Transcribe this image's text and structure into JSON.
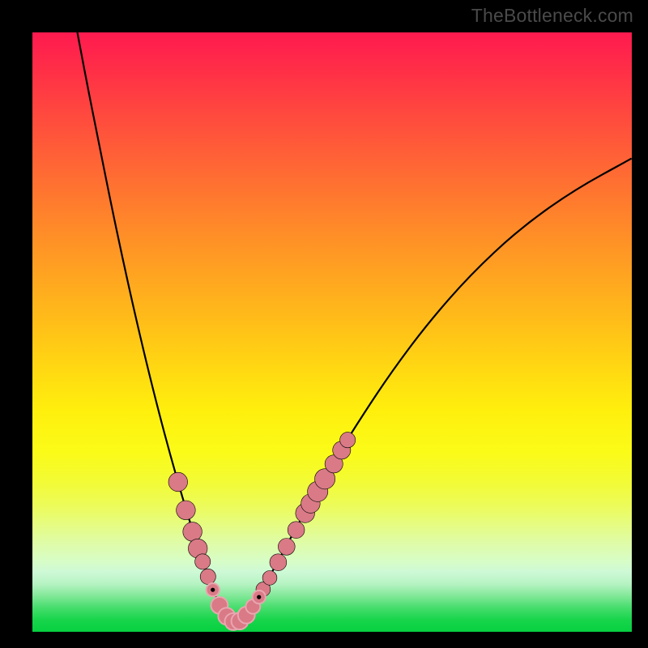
{
  "watermark": "TheBottleneck.com",
  "colors": {
    "frame": "#000000",
    "curve": "#000000",
    "marker_fill": "#d97a86",
    "marker_stroke": "#000000",
    "gradient_top": "#ff1a4f",
    "gradient_bottom": "#06d040"
  },
  "chart_data": {
    "type": "line",
    "title": "",
    "xlabel": "",
    "ylabel": "",
    "xlim": [
      0,
      100
    ],
    "ylim": [
      0,
      100
    ],
    "grid": false,
    "legend": false,
    "description": "V-shaped bottleneck curve with minimum around x≈33; left branch nearly vertical at top, right branch rises more gently; markers cluster on the lower portions of both branches.",
    "curve_points": [
      {
        "x": 7.5,
        "y": 100.0
      },
      {
        "x": 9.0,
        "y": 92.0
      },
      {
        "x": 11.0,
        "y": 82.0
      },
      {
        "x": 13.0,
        "y": 72.0
      },
      {
        "x": 15.0,
        "y": 62.5
      },
      {
        "x": 17.0,
        "y": 53.5
      },
      {
        "x": 19.0,
        "y": 45.0
      },
      {
        "x": 21.0,
        "y": 37.0
      },
      {
        "x": 23.0,
        "y": 29.5
      },
      {
        "x": 25.0,
        "y": 22.5
      },
      {
        "x": 27.0,
        "y": 16.0
      },
      {
        "x": 29.0,
        "y": 10.0
      },
      {
        "x": 30.5,
        "y": 6.0
      },
      {
        "x": 32.0,
        "y": 2.8
      },
      {
        "x": 33.0,
        "y": 1.8
      },
      {
        "x": 34.0,
        "y": 1.6
      },
      {
        "x": 35.0,
        "y": 2.2
      },
      {
        "x": 36.5,
        "y": 4.0
      },
      {
        "x": 38.0,
        "y": 6.5
      },
      {
        "x": 40.0,
        "y": 10.0
      },
      {
        "x": 43.0,
        "y": 15.5
      },
      {
        "x": 46.0,
        "y": 21.0
      },
      {
        "x": 50.0,
        "y": 28.0
      },
      {
        "x": 55.0,
        "y": 36.0
      },
      {
        "x": 60.0,
        "y": 43.5
      },
      {
        "x": 66.0,
        "y": 51.5
      },
      {
        "x": 73.0,
        "y": 59.5
      },
      {
        "x": 81.0,
        "y": 67.0
      },
      {
        "x": 90.0,
        "y": 73.5
      },
      {
        "x": 100.0,
        "y": 79.0
      }
    ],
    "left_markers": [
      {
        "x": 24.3,
        "y": 25.0,
        "r": 1.6
      },
      {
        "x": 25.6,
        "y": 20.3,
        "r": 1.6
      },
      {
        "x": 26.7,
        "y": 16.7,
        "r": 1.6
      },
      {
        "x": 27.6,
        "y": 13.9,
        "r": 1.6
      },
      {
        "x": 28.4,
        "y": 11.7,
        "r": 1.3
      },
      {
        "x": 29.3,
        "y": 9.2,
        "r": 1.3
      }
    ],
    "right_markers": [
      {
        "x": 38.5,
        "y": 7.1,
        "r": 1.2
      },
      {
        "x": 39.6,
        "y": 9.0,
        "r": 1.2
      },
      {
        "x": 41.0,
        "y": 11.6,
        "r": 1.4
      },
      {
        "x": 42.4,
        "y": 14.2,
        "r": 1.4
      },
      {
        "x": 44.0,
        "y": 17.0,
        "r": 1.4
      },
      {
        "x": 45.5,
        "y": 19.8,
        "r": 1.6
      },
      {
        "x": 46.4,
        "y": 21.4,
        "r": 1.6
      },
      {
        "x": 47.6,
        "y": 23.4,
        "r": 1.7
      },
      {
        "x": 48.8,
        "y": 25.5,
        "r": 1.7
      },
      {
        "x": 50.3,
        "y": 28.0,
        "r": 1.5
      },
      {
        "x": 51.6,
        "y": 30.3,
        "r": 1.5
      },
      {
        "x": 52.6,
        "y": 32.0,
        "r": 1.3
      }
    ],
    "valley_markers": [
      {
        "x": 30.1,
        "y": 7.0,
        "r": 1.1
      },
      {
        "x": 31.2,
        "y": 4.4,
        "r": 1.4
      },
      {
        "x": 32.4,
        "y": 2.6,
        "r": 1.4
      },
      {
        "x": 33.5,
        "y": 1.7,
        "r": 1.4
      },
      {
        "x": 34.6,
        "y": 1.8,
        "r": 1.4
      },
      {
        "x": 35.7,
        "y": 2.8,
        "r": 1.4
      },
      {
        "x": 36.8,
        "y": 4.2,
        "r": 1.2
      },
      {
        "x": 37.8,
        "y": 5.8,
        "r": 1.1
      }
    ],
    "inner_dots": [
      {
        "x": 30.1,
        "y": 7.0
      },
      {
        "x": 37.8,
        "y": 5.8
      }
    ]
  }
}
